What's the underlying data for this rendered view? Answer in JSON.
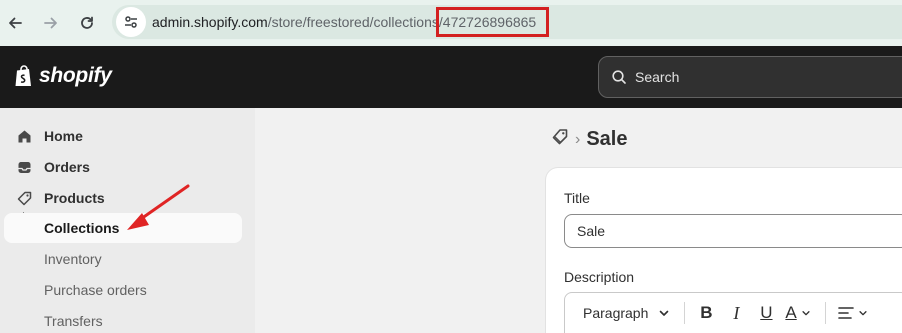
{
  "browser": {
    "url_host": "admin.shopify.com",
    "url_path": "/store/freestored/collections",
    "url_slash": "/",
    "url_id": "472726896865",
    "highlight_color": "#d32020"
  },
  "topbar": {
    "logo_text": "shopify",
    "search_label": "Search",
    "background": "#1a1a1a"
  },
  "sidebar": {
    "items": [
      {
        "label": "Home",
        "icon": "home-icon"
      },
      {
        "label": "Orders",
        "icon": "inbox-icon"
      },
      {
        "label": "Products",
        "icon": "tag-icon"
      },
      {
        "label": "Collections",
        "active": true
      },
      {
        "label": "Inventory"
      },
      {
        "label": "Purchase orders"
      },
      {
        "label": "Transfers"
      }
    ]
  },
  "main": {
    "breadcrumb_icon": "tag-icon",
    "breadcrumb_sep": "›",
    "title": "Sale",
    "form": {
      "title_label": "Title",
      "title_value": "Sale",
      "description_label": "Description",
      "toolbar": {
        "paragraph": "Paragraph",
        "bold": "B",
        "italic": "I",
        "underline": "U",
        "text_color": "A"
      }
    }
  },
  "annotation": {
    "arrow_color": "#e02424"
  }
}
